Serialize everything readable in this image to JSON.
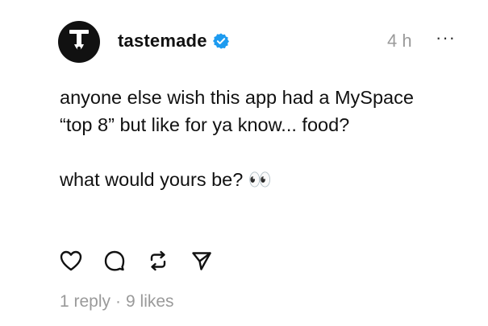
{
  "post": {
    "username": "tastemade",
    "timestamp": "4 h",
    "more_label": "···",
    "body_line1": "anyone else wish this app had a MySpace “top 8” but like for ya know... food?",
    "body_line2": "what would yours be? 👀",
    "actions": {
      "like_icon": "heart-icon",
      "reply_icon": "comment-icon",
      "repost_icon": "repost-icon",
      "share_icon": "send-icon"
    },
    "stats": {
      "replies": "1 reply",
      "separator": "·",
      "likes": "9 likes"
    },
    "colors": {
      "verified": "#1d9bf0",
      "muted": "#9a9a9a",
      "text": "#111111"
    }
  }
}
